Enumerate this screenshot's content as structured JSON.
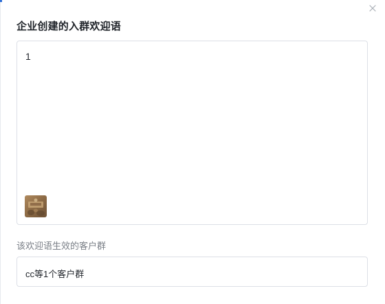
{
  "dialog": {
    "title": "企业创建的入群欢迎语",
    "close_icon": "close-icon"
  },
  "editor": {
    "content": "1",
    "attachment": {
      "type": "image",
      "icon": "image-thumbnail"
    }
  },
  "groups": {
    "label": "该欢迎语生效的客户群",
    "value": "cc等1个客户群"
  },
  "colors": {
    "accent": "#2f6fd6",
    "border": "#dcdfe6",
    "title_text": "#1f2329",
    "label_text": "#7a7f87"
  }
}
